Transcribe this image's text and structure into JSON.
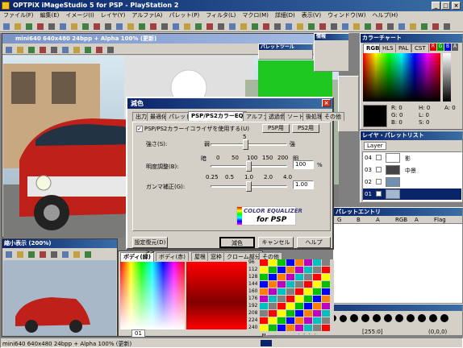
{
  "app": {
    "title": "OPTPiX iMageStudio 5 for PSP - PlayStation 2",
    "menu": [
      "ファイル(F)",
      "編集(E)",
      "イメージ(I)",
      "レイヤ(Y)",
      "アルファ(A)",
      "パレット(P)",
      "フィルタ(L)",
      "マクロ(M)",
      "詳細(D)",
      "表示(V)",
      "ウィンドウ(W)",
      "ヘルプ(H)"
    ]
  },
  "image_window": {
    "title": "mini640  640x480  24bpp + Alpha  100% (更新)"
  },
  "palette_tool": {
    "title": "パレットツール"
  },
  "info_panel": {
    "title": "情報"
  },
  "color_chart": {
    "title": "カラーチャート",
    "tabs": [
      "RGB",
      "HLS",
      "PAL",
      "CST"
    ],
    "chips": [
      "R",
      "G",
      "B",
      "A"
    ],
    "values": {
      "r": "R:    0",
      "g": "G:    0",
      "b": "B:    0",
      "h": "H:    0",
      "l": "L:    0",
      "s": "S:    0",
      "a": "A:    0"
    }
  },
  "dialog": {
    "title": "減色",
    "tabs": [
      "出力",
      "最適化",
      "パレット",
      "PSP/PS2カラーEQ",
      "アルファ",
      "透過色",
      "ソート",
      "後処理",
      "その他"
    ],
    "checkbox_label": "PSP/PS2カラーイコライザを使用する(U)",
    "btn_psp": "PSP用",
    "btn_ps2": "PS2用",
    "strength_label": "強さ(S):",
    "strength_weak": "弱",
    "strength_strong": "強",
    "strength_value_top": "5",
    "brightness_label": "明度調整(B):",
    "brightness_ticks": [
      "暗",
      "0",
      "50",
      "100",
      "150",
      "200",
      "明"
    ],
    "brightness_value": "100",
    "percent": "%",
    "gamma_label": "ガンマ補正(G):",
    "gamma_ticks": [
      "0.25",
      "0.5",
      "1.0",
      "2.0",
      "4.0"
    ],
    "gamma_value": "1.00",
    "logo_line1": "COLOR EQUALIZER",
    "logo_line2": "for PSP",
    "settings_btn": "設定復元(D) >>",
    "ok_btn": "減色",
    "cancel_btn": "キャンセル",
    "help_btn": "ヘルプ"
  },
  "layer_list": {
    "title": "レイヤ・パレットリスト",
    "tab": "Layer",
    "layers": [
      {
        "num": "04",
        "name": "影"
      },
      {
        "num": "03",
        "name": "中景"
      },
      {
        "num": "02",
        "name": ""
      },
      {
        "num": "01",
        "name": ""
      }
    ]
  },
  "palette_entry": {
    "title": "パレットエントリ",
    "cols": [
      "G",
      "B",
      "A",
      "RGB",
      "A",
      "Flag"
    ]
  },
  "zoom_window": {
    "title": "縮小表示 (200%)"
  },
  "parts_window": {
    "tabs": [
      "ボディ(緑)",
      "ボディ(赤)",
      "屋根",
      "窓枠",
      "クローム部分",
      "その他"
    ]
  },
  "pen_panel": {
    "title": "ペン選択",
    "coord1": "(0,0,0)",
    "coord2": "[255:0]",
    "coord3": "(0,0,0)"
  },
  "status_bar": {
    "text": "mini640  640x480  24bpp + Alpha  100% (更新)",
    "frame": "01",
    "rows": [
      "96",
      "112",
      "128",
      "144",
      "160",
      "176",
      "192",
      "208",
      "224",
      "240"
    ]
  },
  "colors": {
    "title_active": "#0a246a",
    "title_gradient_end": "#3a6ea5",
    "window_bg": "#d4d0c8",
    "car_red": "#c0201a",
    "sky_green": "#1ec820"
  }
}
